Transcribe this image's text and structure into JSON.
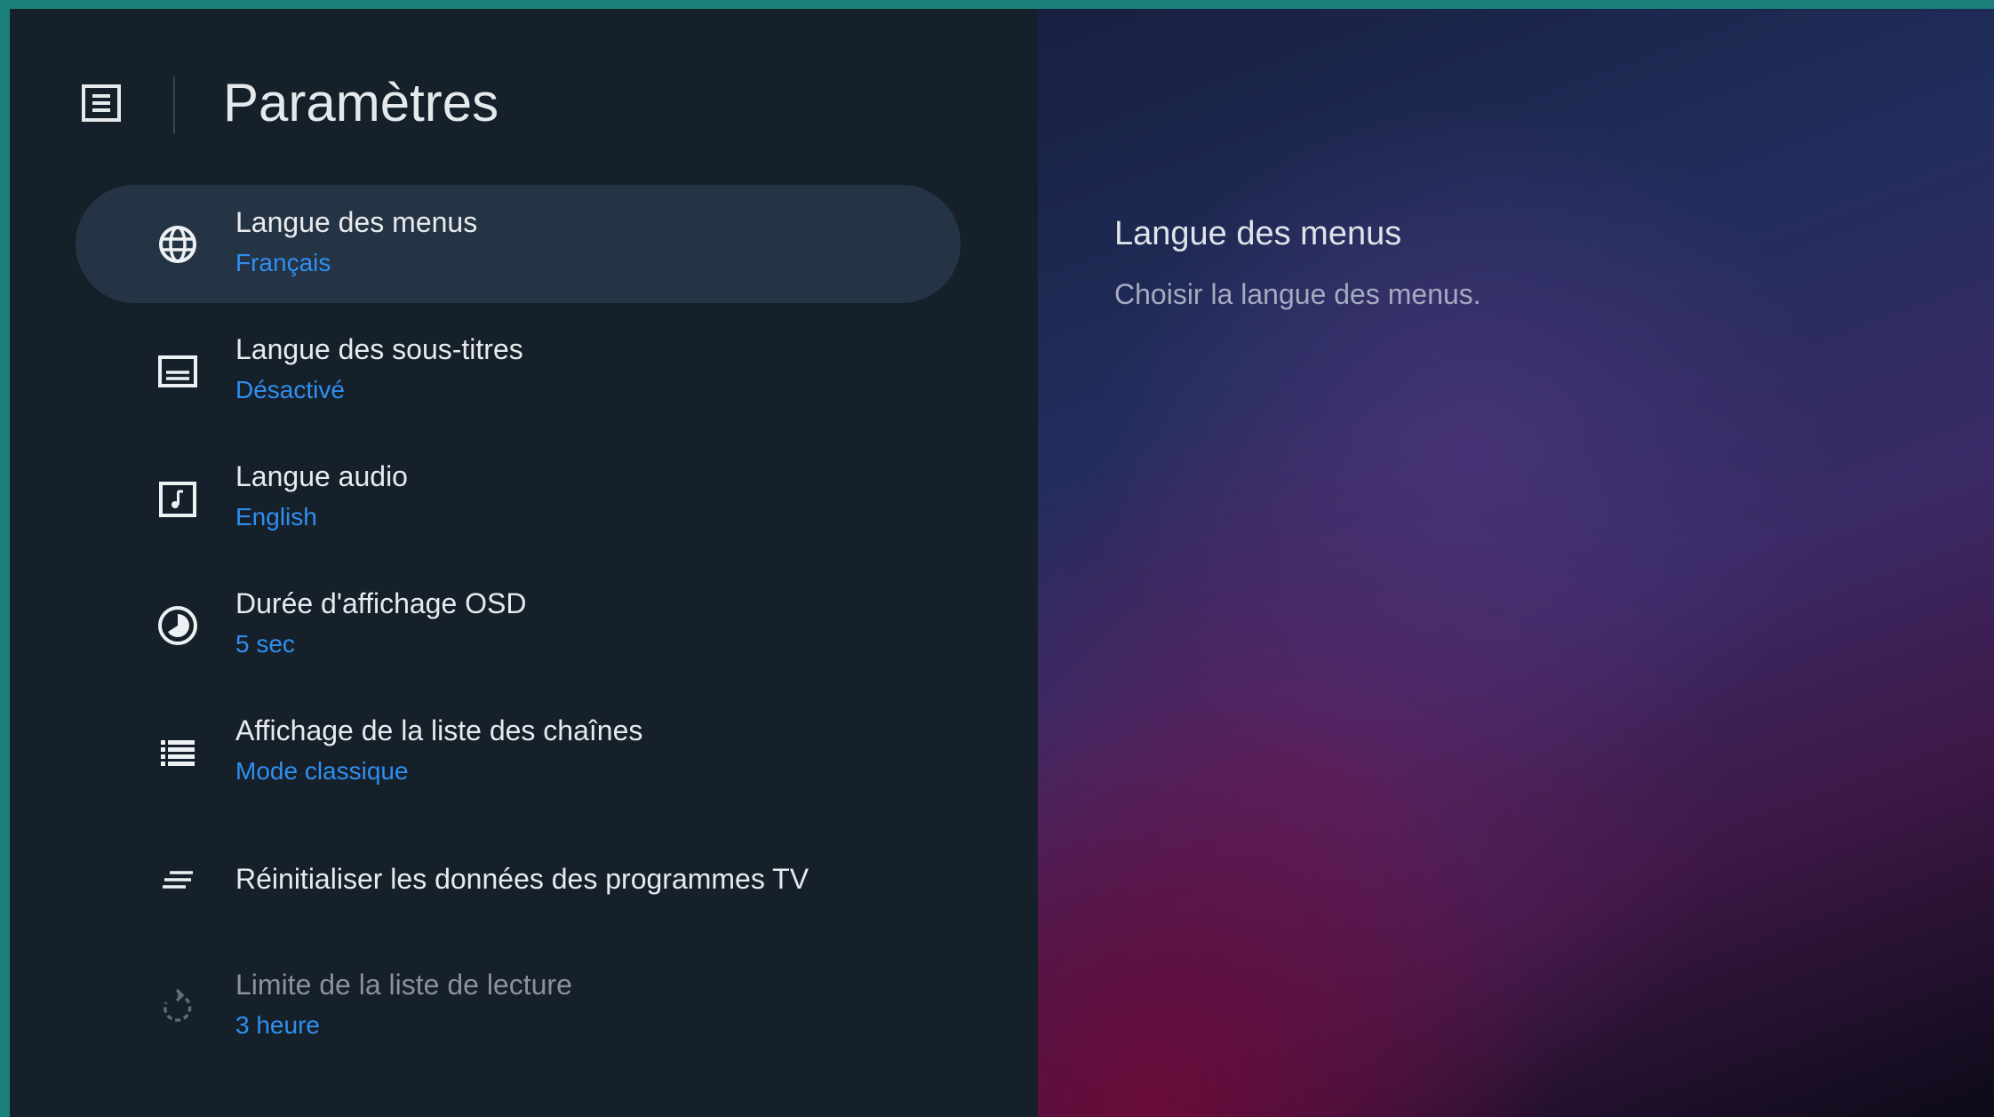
{
  "header": {
    "icon": "settings-list-icon",
    "title": "Paramètres"
  },
  "menu": {
    "items": [
      {
        "icon": "globe-icon",
        "label": "Langue des menus",
        "value": "Français",
        "selected": true
      },
      {
        "icon": "subtitles-icon",
        "label": "Langue des sous-titres",
        "value": "Désactivé"
      },
      {
        "icon": "audio-icon",
        "label": "Langue audio",
        "value": "English"
      },
      {
        "icon": "timer-icon",
        "label": "Durée d'affichage OSD",
        "value": "5 sec"
      },
      {
        "icon": "list-icon",
        "label": "Affichage de la liste des chaînes",
        "value": "Mode classique"
      },
      {
        "icon": "reset-icon",
        "label": "Réinitialiser les données des programmes TV"
      },
      {
        "icon": "replay-icon",
        "label": "Limite de la liste de lecture",
        "value": "3 heure",
        "disabled": true
      }
    ]
  },
  "detail": {
    "title": "Langue des menus",
    "description": "Choisir la langue des menus."
  },
  "colors": {
    "accent": "#2f8ff0",
    "selected_bg": "#253445",
    "panel_bg": "#16202a",
    "frame": "#1b7f7a"
  }
}
